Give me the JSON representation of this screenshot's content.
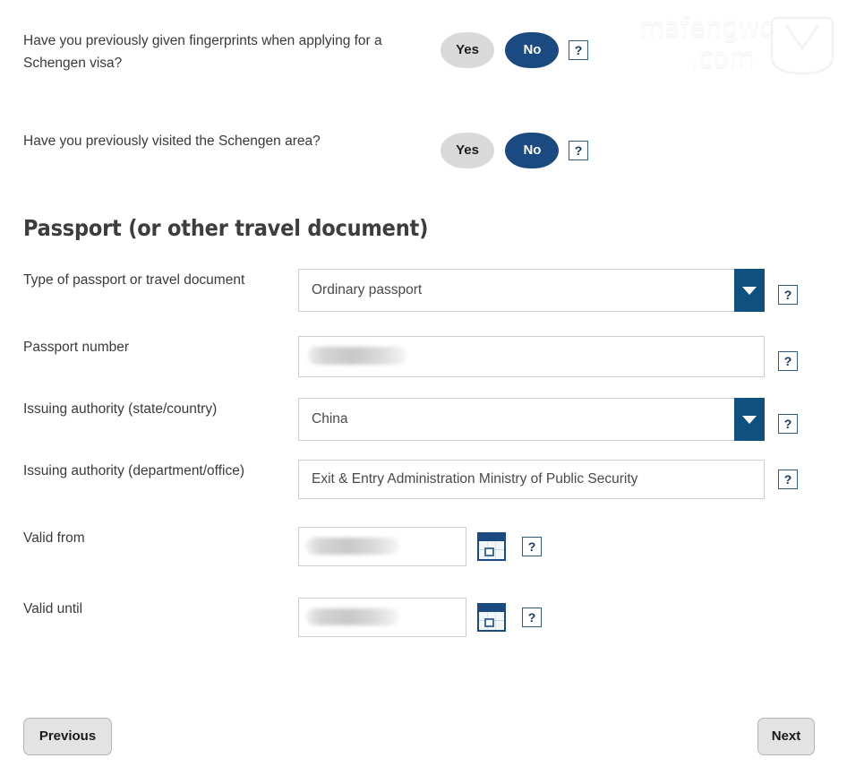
{
  "watermark": {
    "line1": "mafengwo",
    "line2": ".com",
    "logo_icon": "mafengwo-logo-icon"
  },
  "questions": [
    {
      "text": "Have you previously given fingerprints when applying for a Schengen visa?",
      "yes_label": "Yes",
      "no_label": "No",
      "selected": "No",
      "help_label": "?"
    },
    {
      "text": "Have you previously visited the Schengen area?",
      "yes_label": "Yes",
      "no_label": "No",
      "selected": "No",
      "help_label": "?"
    }
  ],
  "section": {
    "heading": "Passport (or other travel document)"
  },
  "fields": {
    "passport_type": {
      "label": "Type of passport or travel document",
      "value": "Ordinary passport",
      "help_label": "?"
    },
    "passport_number": {
      "label": "Passport number",
      "value": "",
      "help_label": "?"
    },
    "issuing_authority_country": {
      "label": "Issuing authority (state/country)",
      "value": "China",
      "help_label": "?"
    },
    "issuing_authority_office": {
      "label": "Issuing authority (department/office)",
      "value": "Exit & Entry Administration Ministry of Public Security",
      "help_label": "?"
    },
    "valid_from": {
      "label": "Valid from",
      "value": "",
      "calendar_icon": "calendar-icon",
      "help_label": "?"
    },
    "valid_until": {
      "label": "Valid until",
      "value": "",
      "calendar_icon": "calendar-icon",
      "help_label": "?"
    }
  },
  "footer": {
    "previous_label": "Previous",
    "next_label": "Next"
  },
  "colors": {
    "navy": "#1a4a80",
    "dropdown_blue": "#10507f",
    "button_gray": "#e3e3e3",
    "toggle_off_gray": "#d9d9d9"
  }
}
